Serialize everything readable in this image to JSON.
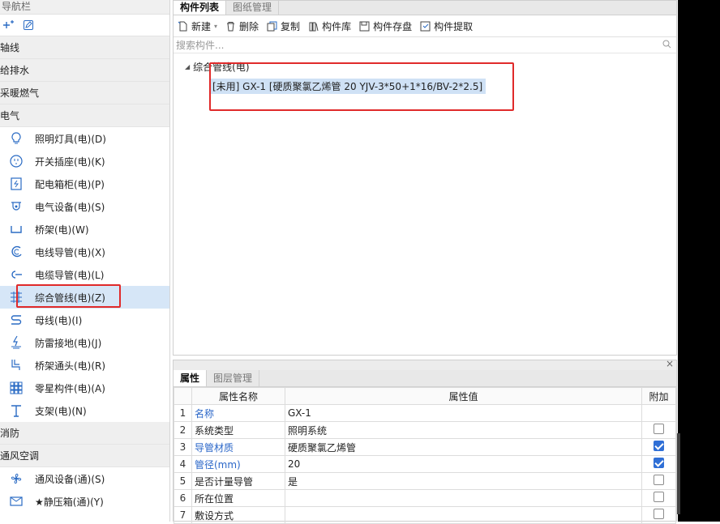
{
  "nav": {
    "title": "导航栏",
    "categories_top": [
      {
        "label": "轴线"
      },
      {
        "label": "给排水"
      },
      {
        "label": "采暖燃气"
      },
      {
        "label": "电气"
      }
    ],
    "items": [
      {
        "label": "照明灯具(电)(D)",
        "icon": "lamp-icon"
      },
      {
        "label": "开关插座(电)(K)",
        "icon": "switch-socket-icon"
      },
      {
        "label": "配电箱柜(电)(P)",
        "icon": "distribution-box-icon"
      },
      {
        "label": "电气设备(电)(S)",
        "icon": "electrical-equipment-icon"
      },
      {
        "label": "桥架(电)(W)",
        "icon": "cable-tray-icon"
      },
      {
        "label": "电线导管(电)(X)",
        "icon": "wire-conduit-icon"
      },
      {
        "label": "电缆导管(电)(L)",
        "icon": "cable-conduit-icon"
      },
      {
        "label": "综合管线(电)(Z)",
        "icon": "integrated-pipeline-icon"
      },
      {
        "label": "母线(电)(I)",
        "icon": "busbar-icon"
      },
      {
        "label": "防雷接地(电)(J)",
        "icon": "lightning-ground-icon"
      },
      {
        "label": "桥架通头(电)(R)",
        "icon": "tray-fitting-icon"
      },
      {
        "label": "零星构件(电)(A)",
        "icon": "misc-component-icon"
      },
      {
        "label": "支架(电)(N)",
        "icon": "bracket-icon"
      }
    ],
    "categories_bottom": [
      {
        "label": "消防"
      },
      {
        "label": "通风空调"
      }
    ],
    "items_bottom": [
      {
        "label": "通风设备(通)(S)",
        "icon": "fan-icon"
      },
      {
        "label": "★静压箱(通)(Y)",
        "icon": "plenum-box-icon"
      }
    ]
  },
  "component_panel": {
    "tabs": [
      "构件列表",
      "图纸管理"
    ],
    "toolbar": {
      "new": "新建",
      "delete": "删除",
      "copy": "复制",
      "library": "构件库",
      "save": "构件存盘",
      "extract": "构件提取"
    },
    "search_placeholder": "搜索构件...",
    "tree": {
      "group": "综合管线(电)",
      "leaf": "[未用] GX-1 [硬质聚氯乙烯管 20 YJV-3*50+1*16/BV-2*2.5]"
    }
  },
  "properties_panel": {
    "tabs": [
      "属性",
      "图层管理"
    ],
    "columns": [
      "属性名称",
      "属性值",
      "附加"
    ],
    "rows": [
      {
        "num": "1",
        "name": "名称",
        "value": "GX-1",
        "blue": true,
        "checkbox": "none"
      },
      {
        "num": "2",
        "name": "系统类型",
        "value": "照明系统",
        "blue": false,
        "checkbox": "off"
      },
      {
        "num": "3",
        "name": "导管材质",
        "value": "硬质聚氯乙烯管",
        "blue": true,
        "checkbox": "on"
      },
      {
        "num": "4",
        "name": "管径(mm)",
        "value": "20",
        "blue": true,
        "checkbox": "on"
      },
      {
        "num": "5",
        "name": "是否计量导管",
        "value": "是",
        "blue": false,
        "checkbox": "off"
      },
      {
        "num": "6",
        "name": "所在位置",
        "value": "",
        "blue": false,
        "checkbox": "off"
      },
      {
        "num": "7",
        "name": "敷设方式",
        "value": "",
        "blue": false,
        "checkbox": "off"
      }
    ]
  },
  "colors": {
    "accent_blue": "#2a66c8",
    "highlight_red": "#e02a2a",
    "selection": "#d6e6f7"
  }
}
